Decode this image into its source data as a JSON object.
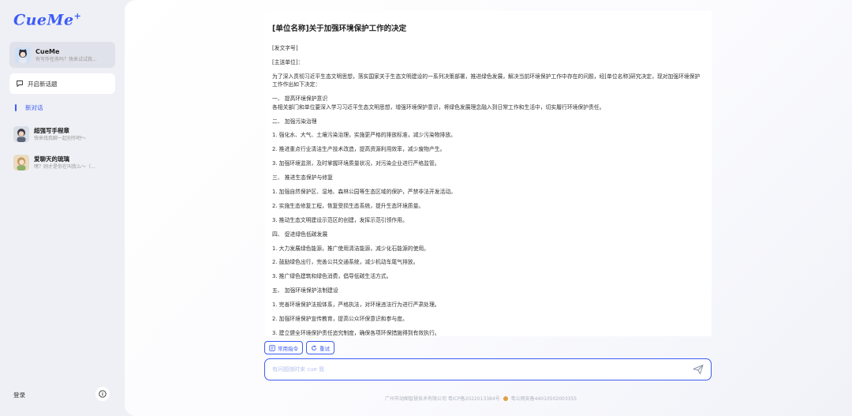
{
  "sidebar": {
    "logo": "CueMe",
    "logo_mark": "+",
    "agent": {
      "title": "CueMe",
      "subtitle": "有写作任务吗？快来试试我..."
    },
    "new_topic": "开启新话题",
    "current_session": "新对话",
    "sessions": [
      {
        "title": "超强写手程章",
        "subtitle": "快来找我聊一起创作吧～"
      },
      {
        "title": "爱聊天的琉璃",
        "subtitle": "嘿？刚才是你在叫我么～（..."
      }
    ],
    "login": "登录"
  },
  "document": {
    "title": "[单位名称]关于加强环境保护工作的决定",
    "lines": [
      {
        "text": "[发文字号]",
        "kind": "p"
      },
      {
        "text": "[主送单位]：",
        "kind": "p"
      },
      {
        "text": "为了深入贯彻习近平生态文明思想，落实国家关于生态文明建设的一系列决策部署，推进绿色发展，解决当前环境保护工作中存在的问题，经[单位名称]研究决定，现对加强环境保护工作作出如下决定：",
        "kind": "p"
      },
      {
        "text": "一、 提高环境保护意识",
        "kind": "tight"
      },
      {
        "text": "各相关部门和单位要深入学习习近平生态文明思想，增强环境保护意识，将绿色发展理念融入到日常工作和生活中，切实履行环境保护责任。",
        "kind": "p"
      },
      {
        "text": "二、 加强污染治理",
        "kind": "p"
      },
      {
        "text": "1. 强化水、大气、土壤污染治理，实施更严格的排放标准，减少污染物排放。",
        "kind": "p"
      },
      {
        "text": "2. 推进重点行业清洁生产技术改造，提高资源利用效率，减少废物产生。",
        "kind": "p"
      },
      {
        "text": "3. 加强环境监测，及时掌握环境质量状况，对污染企业进行严格监管。",
        "kind": "p"
      },
      {
        "text": "三、 推进生态保护与修复",
        "kind": "p"
      },
      {
        "text": "1. 加强自然保护区、湿地、森林公园等生态区域的保护，严禁非法开发活动。",
        "kind": "p"
      },
      {
        "text": "2. 实施生态修复工程，恢复受损生态系统，提升生态环境质量。",
        "kind": "p"
      },
      {
        "text": "3. 推动生态文明建设示范区的创建，发挥示范引领作用。",
        "kind": "p"
      },
      {
        "text": "四、 促进绿色低碳发展",
        "kind": "p"
      },
      {
        "text": "1. 大力发展绿色能源，推广使用清洁能源，减少化石能源的使用。",
        "kind": "p"
      },
      {
        "text": "2. 鼓励绿色出行，完善公共交通系统，减少机动车尾气排放。",
        "kind": "p"
      },
      {
        "text": "3. 推广绿色建筑和绿色消费，倡导低碳生活方式。",
        "kind": "p"
      },
      {
        "text": "五、 加强环境保护法制建设",
        "kind": "p"
      },
      {
        "text": "1. 完善环境保护法规体系，严格执法，对环境违法行为进行严肃处理。",
        "kind": "p"
      },
      {
        "text": "2. 加强环境保护宣传教育，提高公众环保意识和参与度。",
        "kind": "p"
      },
      {
        "text": "3. 建立健全环境保护责任追究制度，确保各项环保措施得到有效执行。",
        "kind": "p"
      }
    ]
  },
  "actions": {
    "common_commands": "常用指令",
    "retry": "重试"
  },
  "input": {
    "placeholder": "有问题随时来 cue 我",
    "value": ""
  },
  "footer": {
    "icp": "广州市动图智慧技术有限公司 粤ICP备2022013384号",
    "police": "粤公网安备44010502003355"
  },
  "colors": {
    "accent": "#3d5cf5"
  }
}
